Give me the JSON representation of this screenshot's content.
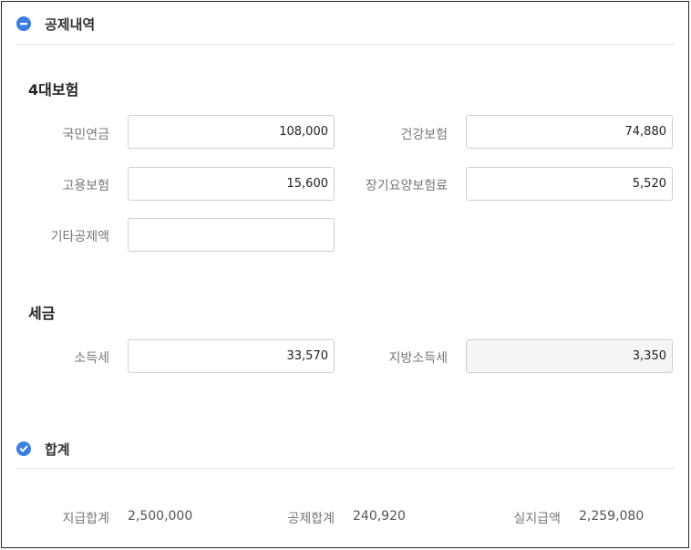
{
  "deductions": {
    "title": "공제내역",
    "insurance": {
      "title": "4대보험",
      "national_pension": {
        "label": "국민연금",
        "value": "108,000"
      },
      "health_insurance": {
        "label": "건강보험",
        "value": "74,880"
      },
      "employment_insurance": {
        "label": "고용보험",
        "value": "15,600"
      },
      "long_term_care": {
        "label": "장기요양보험료",
        "value": "5,520"
      },
      "other_deduction": {
        "label": "기타공제액",
        "value": ""
      }
    },
    "tax": {
      "title": "세금",
      "income_tax": {
        "label": "소득세",
        "value": "33,570"
      },
      "local_income_tax": {
        "label": "지방소득세",
        "value": "3,350"
      }
    }
  },
  "totals": {
    "title": "합계",
    "payment_total": {
      "label": "지급합계",
      "value": "2,500,000"
    },
    "deduction_total": {
      "label": "공제합계",
      "value": "240,920"
    },
    "net_pay": {
      "label": "실지급액",
      "value": "2,259,080"
    }
  },
  "colors": {
    "accent": "#3b7de0",
    "border": "#cfcfcf",
    "readonly_bg": "#f5f5f5"
  },
  "icons": {
    "deductions": "minus-circle-icon",
    "totals": "check-circle-icon"
  }
}
